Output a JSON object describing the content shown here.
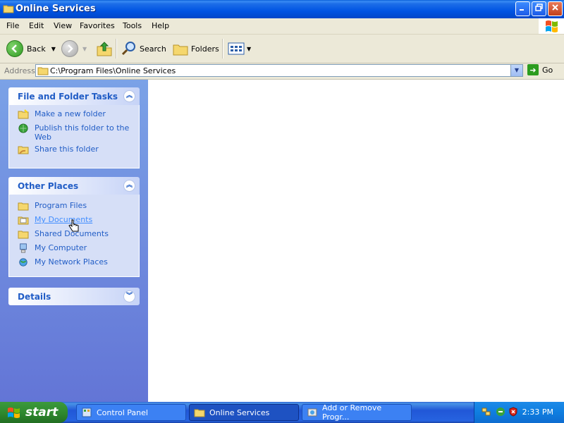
{
  "window": {
    "title": "Online Services"
  },
  "menu": [
    "File",
    "Edit",
    "View",
    "Favorites",
    "Tools",
    "Help"
  ],
  "toolbar": {
    "back_label": "Back",
    "search_label": "Search",
    "folders_label": "Folders"
  },
  "address": {
    "label": "Address",
    "value": "C:\\Program Files\\Online Services",
    "go_label": "Go"
  },
  "panels": {
    "file_tasks": {
      "title": "File and Folder Tasks",
      "items": [
        {
          "label": "Make a new folder",
          "icon": "new-folder-icon"
        },
        {
          "label": "Publish this folder to the Web",
          "icon": "publish-web-icon"
        },
        {
          "label": "Share this folder",
          "icon": "share-folder-icon"
        }
      ]
    },
    "other_places": {
      "title": "Other Places",
      "items": [
        {
          "label": "Program Files",
          "icon": "folder-icon"
        },
        {
          "label": "My Documents",
          "icon": "my-documents-icon"
        },
        {
          "label": "Shared Documents",
          "icon": "folder-icon"
        },
        {
          "label": "My Computer",
          "icon": "my-computer-icon"
        },
        {
          "label": "My Network Places",
          "icon": "network-places-icon"
        }
      ]
    },
    "details": {
      "title": "Details"
    }
  },
  "taskbar": {
    "start_label": "start",
    "tasks": [
      {
        "label": "Control Panel"
      },
      {
        "label": "Online Services"
      },
      {
        "label": "Add or Remove Progr..."
      }
    ],
    "clock": "2:33 PM"
  },
  "colors": {
    "title_blue": "#0054e3",
    "link_blue": "#215dc6",
    "start_green": "#2f8a2f"
  }
}
